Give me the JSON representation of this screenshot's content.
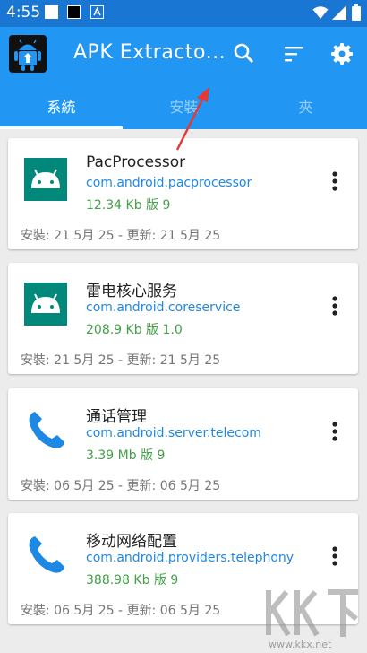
{
  "status": {
    "time": "4:55"
  },
  "appbar": {
    "title": "APK Extracto..."
  },
  "tabs": [
    {
      "label": "系統",
      "active": true
    },
    {
      "label": "安裝",
      "active": false
    },
    {
      "label": "夾",
      "active": false
    }
  ],
  "apps": [
    {
      "name": "PacProcessor",
      "package": "com.android.pacprocessor",
      "size": "12.34 Kb 版 9",
      "dates": "安裝: 21 5月 25 - 更新: 21 5月 25",
      "icon": "android-icon"
    },
    {
      "name": "雷电核心服务",
      "package": "com.android.coreservice",
      "size": "208.9 Kb 版 1.0",
      "dates": "安裝: 21 5月 25 - 更新: 21 5月 25",
      "icon": "android-icon"
    },
    {
      "name": "通话管理",
      "package": "com.android.server.telecom",
      "size": "3.39 Mb 版 9",
      "dates": "安裝: 06 5月 25 - 更新: 06 5月 25",
      "icon": "phone-icon"
    },
    {
      "name": "移动网络配置",
      "package": "com.android.providers.telephony",
      "size": "388.98 Kb 版 9",
      "dates": "安裝: 06 5月 25 - 更新: 06 5月 25",
      "icon": "phone-icon"
    }
  ],
  "watermark": {
    "text": "www.kkx.net"
  },
  "colors": {
    "primary": "#2196f3",
    "statusbar": "#1976d2",
    "package": "#1e88e5",
    "size": "#43a047",
    "arrow": "#e53935"
  }
}
